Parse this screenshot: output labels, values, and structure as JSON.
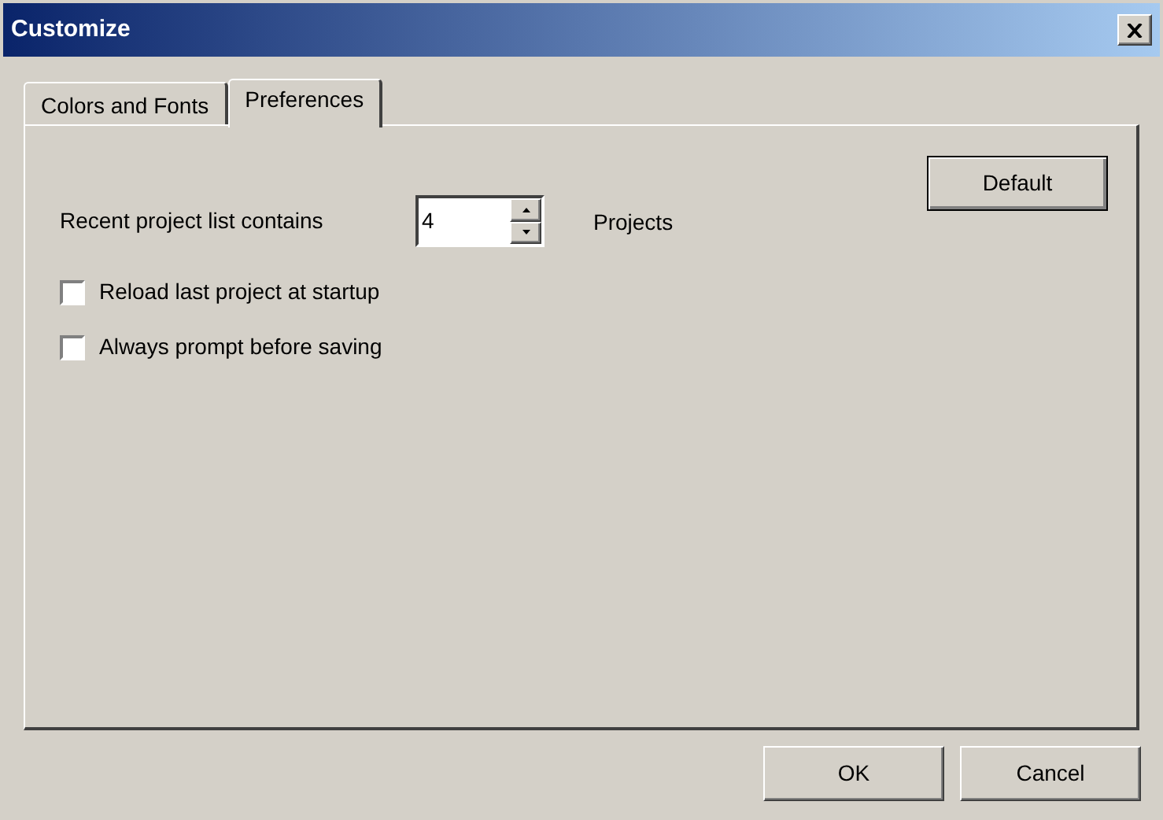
{
  "window": {
    "title": "Customize"
  },
  "tabs": [
    {
      "label": "Colors and Fonts",
      "selected": false
    },
    {
      "label": "Preferences",
      "selected": true
    }
  ],
  "recent": {
    "label": "Recent project list contains",
    "value": "4",
    "unit": "Projects"
  },
  "default_button": "Default",
  "checkboxes": [
    {
      "label": "Reload last project at startup",
      "checked": false
    },
    {
      "label": "Always prompt before saving",
      "checked": false
    }
  ],
  "buttons": [
    "OK",
    "Cancel"
  ]
}
